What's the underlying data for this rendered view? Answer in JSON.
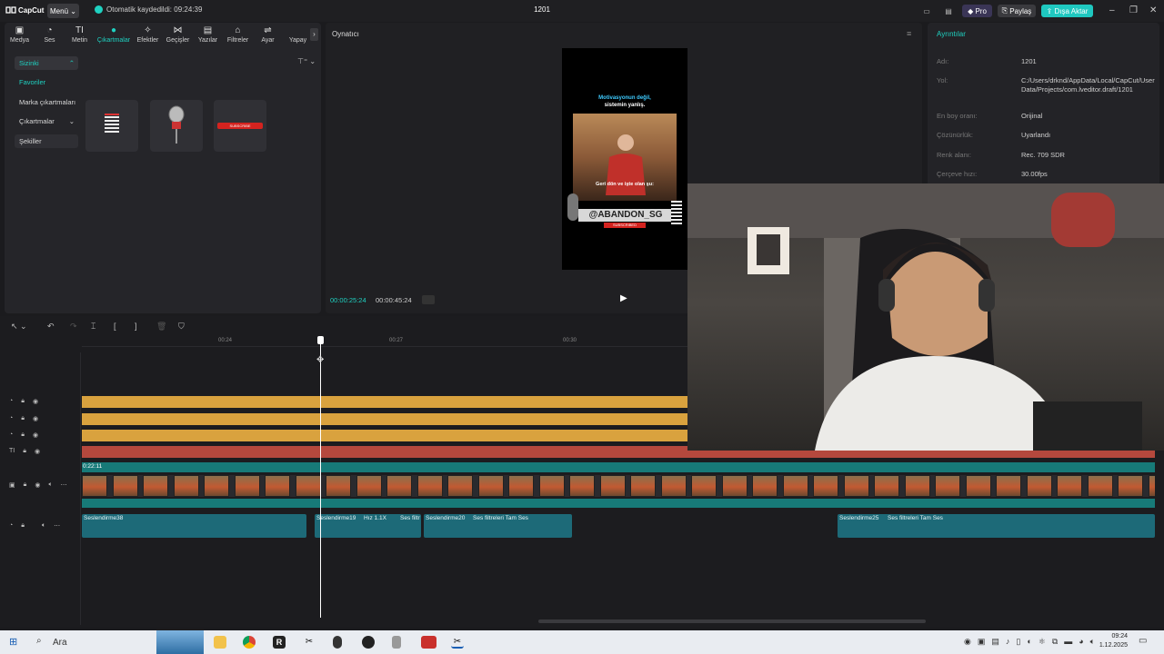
{
  "titlebar": {
    "logo": "CapCut",
    "menu": "Menü",
    "autosave": "Otomatik kaydedildi: 09:24:39",
    "project_name": "1201",
    "pro": "Pro",
    "share": "Paylaş",
    "export": "Dışa Aktar"
  },
  "tabs": [
    {
      "label": "Medya",
      "icon": "media-icon"
    },
    {
      "label": "Ses",
      "icon": "audio-icon"
    },
    {
      "label": "Metin",
      "icon": "text-icon"
    },
    {
      "label": "Çıkartmalar",
      "icon": "sticker-icon"
    },
    {
      "label": "Efektler",
      "icon": "effects-icon"
    },
    {
      "label": "Geçişler",
      "icon": "transition-icon"
    },
    {
      "label": "Yazılar",
      "icon": "captions-icon"
    },
    {
      "label": "Filtreler",
      "icon": "filter-icon"
    },
    {
      "label": "Ayar",
      "icon": "adjust-icon"
    },
    {
      "label": "Yapay",
      "icon": "ai-icon"
    }
  ],
  "sidebar": {
    "section": "Sizinki",
    "items": [
      "Favoriler",
      "Marka çıkartmaları",
      "Çıkartmalar",
      "Şekiller"
    ]
  },
  "player": {
    "title": "Oynatıcı",
    "current_time": "00:00:25:24",
    "total_time": "00:00:45:24",
    "caption_top": "Motivasyonun değil,",
    "caption_top2": "sistemin yanlış.",
    "caption_bottom": "Geri dön ve işte olan şu:",
    "handle": "@ABANDON_SG",
    "subscribe": "SUBSCRIBED"
  },
  "details": {
    "title": "Ayrıntılar",
    "rows": [
      {
        "k": "Adı:",
        "v": "1201"
      },
      {
        "k": "Yol:",
        "v": "C:/Users/drknd/AppData/Local/CapCut/User Data/Projects/com.lveditor.draft/1201"
      },
      {
        "k": "En boy oranı:",
        "v": "Orijinal"
      },
      {
        "k": "Çözünürlük:",
        "v": "Uyarlandı"
      },
      {
        "k": "Renk alanı:",
        "v": "Rec. 709 SDR"
      },
      {
        "k": "Çerçeve hızı:",
        "v": "30.00fps"
      }
    ]
  },
  "timeline": {
    "ruler": [
      "00:24",
      "00:27",
      "00:30"
    ],
    "video_start": "0:22:11",
    "audio_clips": [
      {
        "label": "Seslendirme38"
      },
      {
        "label": "Seslendirme19"
      },
      {
        "label": "Hız 1.1X"
      },
      {
        "label": "Ses filtr"
      },
      {
        "label": "Seslendirme20"
      },
      {
        "label": "Ses filtreleri Tam Ses"
      },
      {
        "label": "Seslendirme25"
      },
      {
        "label": "Ses filtreleri Tam Ses"
      }
    ]
  },
  "taskbar": {
    "search": "Ara",
    "time": "09:24",
    "date": "1.12.2025"
  },
  "colors": {
    "accent": "#1fd1c1",
    "text_track": "#d9a23e",
    "red_track": "#b5483d",
    "audio": "#1d6a78"
  }
}
